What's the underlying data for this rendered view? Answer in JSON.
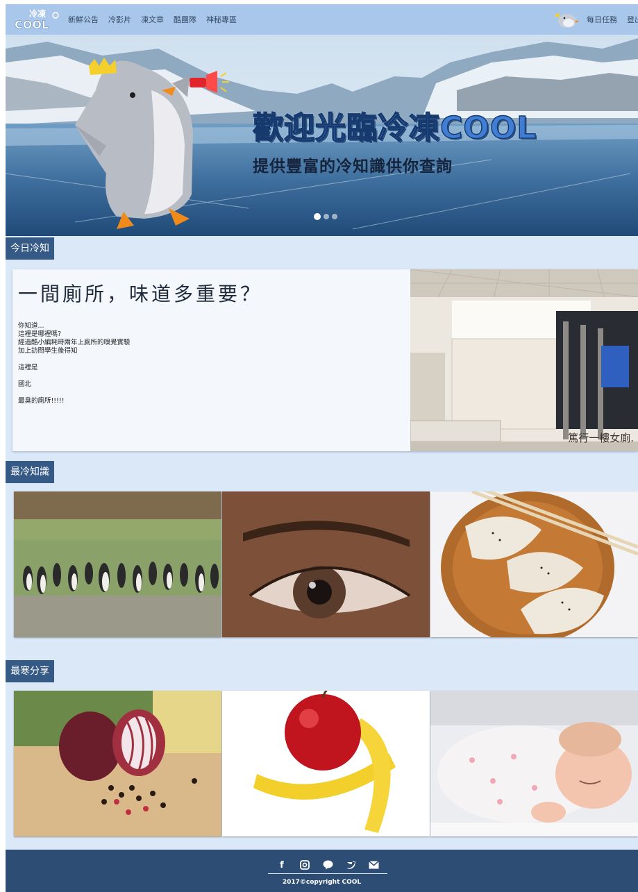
{
  "nav": {
    "logo_text": "冷凍COOL",
    "links": [
      "新鮮公告",
      "冷影片",
      "凍文章",
      "酷團隊",
      "神秘專區"
    ],
    "daily_task": "每日任務",
    "login": "登出"
  },
  "hero": {
    "title": "歡迎光臨冷凍COOL",
    "subtitle": "提供豐富的冷知識供你查詢",
    "slides": 3,
    "active_slide": 1
  },
  "today": {
    "section_label": "今日冷知",
    "title": "一間廁所，味道多重要？",
    "lines": [
      "你知道...",
      "這裡是哪裡嗎?",
      "經過酷小編耗時兩年上廁所的嗅覺實驗",
      "加上訪問學生後得知",
      "",
      "這裡是",
      "",
      "國北",
      "",
      "最臭的廁所!!!!!"
    ],
    "image_caption": "篤行一樓女廁."
  },
  "coldest": {
    "section_label": "最冷知識",
    "tiles": [
      "penguins",
      "eye",
      "dumplings"
    ]
  },
  "sharing": {
    "section_label": "最寒分享",
    "tiles": [
      "onion-pepper",
      "apple-banana",
      "sleeping-baby"
    ]
  },
  "footer": {
    "icons": [
      "facebook-icon",
      "instagram-icon",
      "line-icon",
      "twitter-icon",
      "mail-icon"
    ],
    "copyright": "2017©copyright COOL"
  },
  "colors": {
    "nav_bg": "#a9c7ea",
    "page_bg": "#dbe8f8",
    "section_label_bg": "#355a86",
    "footer_bg": "#2e4d74",
    "hero_title": "#3f7ed4"
  }
}
